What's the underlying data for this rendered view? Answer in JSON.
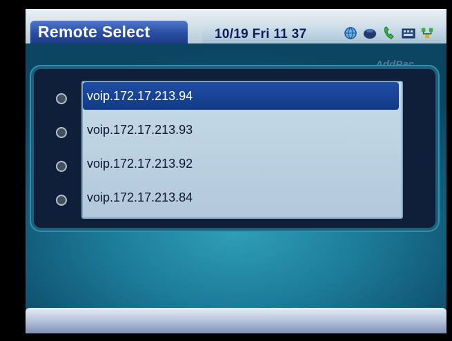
{
  "header": {
    "title": "Remote Select",
    "datetime": "10/19 Fri 11 37",
    "status_icons": [
      "globe-icon",
      "phone-handset-icon",
      "call-icon",
      "keyboard-icon",
      "network-icon"
    ]
  },
  "watermark": "AddPac",
  "remote_list": {
    "selected_index": 0,
    "items": [
      {
        "label": "voip.172.17.213.94"
      },
      {
        "label": "voip.172.17.213.93"
      },
      {
        "label": "voip.172.17.213.92"
      },
      {
        "label": "voip.172.17.213.84"
      }
    ]
  }
}
